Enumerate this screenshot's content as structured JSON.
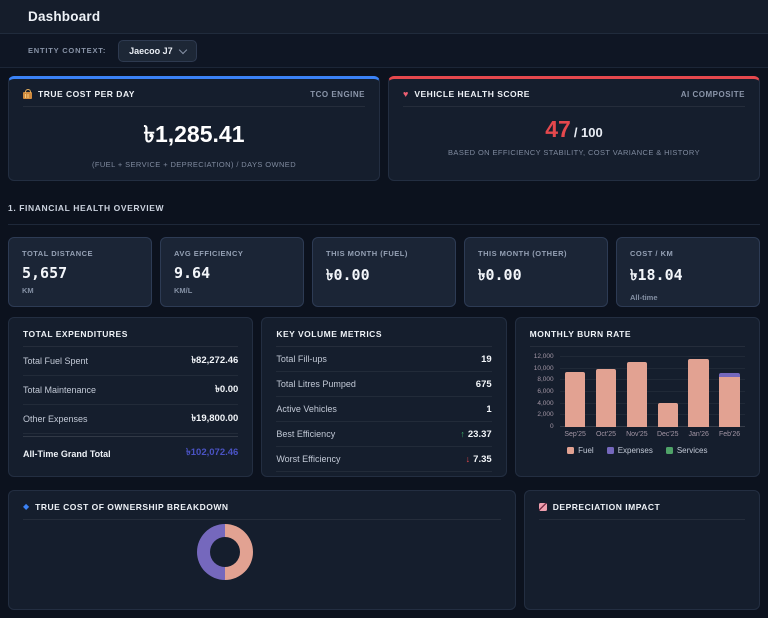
{
  "header": {
    "title": "Dashboard"
  },
  "entity_bar": {
    "label": "ENTITY CONTEXT:",
    "selected": "Jaecoo J7"
  },
  "icons": {
    "heart": "♥",
    "diamond": "◆",
    "up_arrow": "↑",
    "down_arrow": "↓"
  },
  "colors": {
    "tco_accent": "#3b82f6",
    "health_accent": "#e5484d",
    "grand_total": "#4a53c4",
    "fuel": "#e2a292",
    "expenses": "#7568bd",
    "services": "#4fa368"
  },
  "hero_cards": {
    "tco": {
      "title": "TRUE COST PER DAY",
      "tag": "TCO ENGINE",
      "value": "৳1,285.41",
      "subtitle": "(FUEL + SERVICE + DEPRECIATION) / DAYS OWNED"
    },
    "health": {
      "title": "VEHICLE HEALTH SCORE",
      "tag": "AI COMPOSITE",
      "score": "47",
      "score_suffix": "/ 100",
      "subtitle": "BASED ON EFFICIENCY STABILITY, COST VARIANCE & HISTORY"
    }
  },
  "section": {
    "title": "1. FINANCIAL HEALTH OVERVIEW"
  },
  "stat_cards": [
    {
      "label": "TOTAL DISTANCE",
      "value": "5,657",
      "unit": "KM"
    },
    {
      "label": "AVG EFFICIENCY",
      "value": "9.64",
      "unit": "KM/L"
    },
    {
      "label": "THIS MONTH (FUEL)",
      "value": "৳0.00",
      "unit": ""
    },
    {
      "label": "THIS MONTH (OTHER)",
      "value": "৳0.00",
      "unit": ""
    },
    {
      "label": "COST / KM",
      "value": "৳18.04",
      "unit": "All-time"
    }
  ],
  "expenditures": {
    "title": "TOTAL EXPENDITURES",
    "rows": [
      {
        "label": "Total Fuel Spent",
        "value": "৳82,272.46"
      },
      {
        "label": "Total Maintenance",
        "value": "৳0.00"
      },
      {
        "label": "Other Expenses",
        "value": "৳19,800.00"
      }
    ],
    "total_label": "All-Time Grand Total",
    "total_value": "৳102,072.46"
  },
  "volume_metrics": {
    "title": "KEY VOLUME METRICS",
    "rows": [
      {
        "label": "Total Fill-ups",
        "value": "19",
        "arrow": ""
      },
      {
        "label": "Total Litres Pumped",
        "value": "675",
        "arrow": ""
      },
      {
        "label": "Active Vehicles",
        "value": "1",
        "arrow": ""
      },
      {
        "label": "Best Efficiency",
        "value": "23.37",
        "arrow": "up"
      },
      {
        "label": "Worst Efficiency",
        "value": "7.35",
        "arrow": "down"
      }
    ]
  },
  "chart_data": {
    "type": "bar",
    "title": "MONTHLY BURN RATE",
    "stacked": true,
    "grid": true,
    "legend_position": "bottom",
    "categories": [
      "Sep'25",
      "Oct'25",
      "Nov'25",
      "Dec'25",
      "Jan'26",
      "Feb'26"
    ],
    "series": [
      {
        "name": "Fuel",
        "color": "#e2a292",
        "values": [
          9400,
          9900,
          11100,
          4200,
          11600,
          8500
        ]
      },
      {
        "name": "Expenses",
        "color": "#7568bd",
        "values": [
          0,
          0,
          0,
          0,
          0,
          700
        ]
      },
      {
        "name": "Services",
        "color": "#4fa368",
        "values": [
          0,
          0,
          0,
          0,
          0,
          0
        ]
      }
    ],
    "ylim": [
      0,
      12000
    ],
    "ytick_step": 2000,
    "yticks": [
      "12,000",
      "10,000",
      "8,000",
      "6,000",
      "4,000",
      "2,000",
      "0"
    ]
  },
  "bottom_cards": {
    "tco_breakdown": {
      "title": "TRUE COST OF OWNERSHIP BREAKDOWN"
    },
    "depreciation": {
      "title": "DEPRECIATION IMPACT"
    }
  }
}
